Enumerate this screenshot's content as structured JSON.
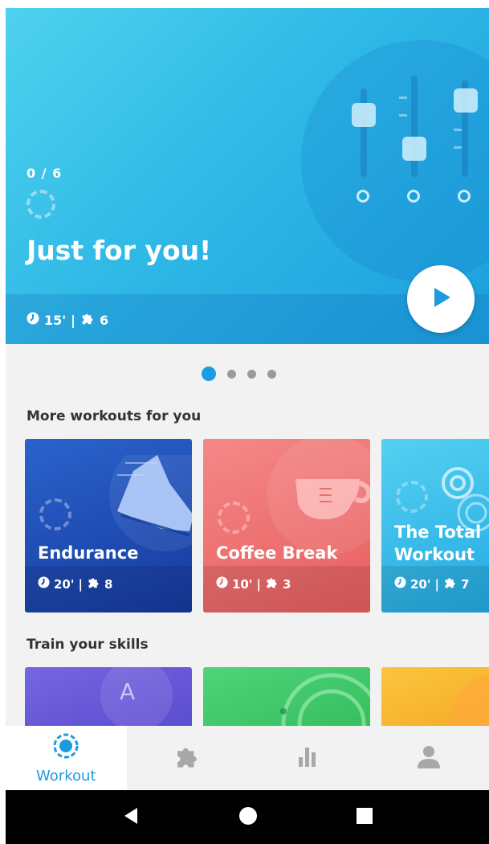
{
  "hero": {
    "progress": "0 / 6",
    "title": "Just for you!",
    "duration": "15'",
    "separator": "|",
    "exercise_count": "6",
    "play_icon": "play-icon"
  },
  "pager": {
    "count": 4,
    "active_index": 0
  },
  "more_workouts": {
    "title": "More workouts for you",
    "cards": [
      {
        "title": "Endurance",
        "duration": "20'",
        "separator": "|",
        "count": "8",
        "color": "#1b4fb8"
      },
      {
        "title": "Coffee Break",
        "duration": "10'",
        "separator": "|",
        "count": "3",
        "color": "#ef6f6f"
      },
      {
        "title": "The Total Workout",
        "title_line1": "The Total",
        "title_line2": "Workout",
        "duration": "20'",
        "separator": "|",
        "count": "7",
        "color": "#2db6e8"
      }
    ]
  },
  "train_skills": {
    "title": "Train your skills",
    "cards": [
      {
        "color": "#6a5ad8",
        "letter": "A"
      },
      {
        "color": "#3ec766"
      },
      {
        "color": "#f6b52a"
      }
    ]
  },
  "bottom_nav": {
    "items": [
      {
        "label": "Workout",
        "icon": "workout-icon",
        "active": true
      },
      {
        "label": "",
        "icon": "puzzle-icon"
      },
      {
        "label": "",
        "icon": "stats-icon"
      },
      {
        "label": "",
        "icon": "profile-icon"
      }
    ]
  },
  "system_nav": [
    "back-icon",
    "home-icon",
    "recents-icon"
  ],
  "colors": {
    "accent": "#1d9be0",
    "hero": "#2fb9e6"
  }
}
